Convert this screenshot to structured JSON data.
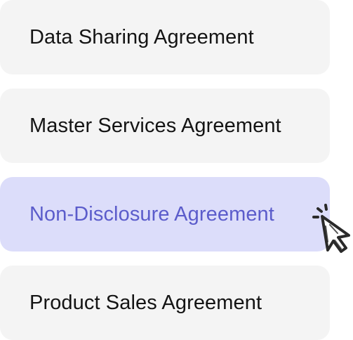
{
  "options": [
    {
      "label": "Data Sharing Agreement",
      "selected": false
    },
    {
      "label": "Master Services Agreement",
      "selected": false
    },
    {
      "label": "Non-Disclosure Agreement",
      "selected": true
    },
    {
      "label": "Product Sales Agreement",
      "selected": false
    }
  ],
  "colors": {
    "option_background": "#f4f4f4",
    "option_text": "#141414",
    "selected_background": "#dcddfa",
    "selected_text": "#5b5ccb",
    "cursor_outline": "#2a2a2a"
  },
  "icons": {
    "cursor": "pointer-cursor-icon"
  }
}
